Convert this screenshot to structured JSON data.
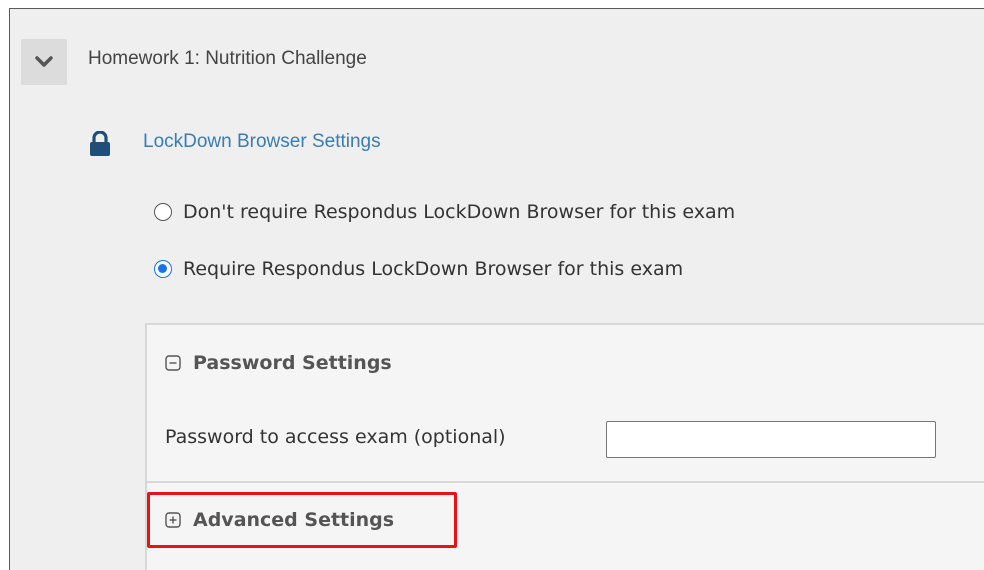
{
  "quiz": {
    "title": "Homework 1: Nutrition Challenge"
  },
  "lockdown": {
    "link_label": "LockDown Browser Settings",
    "options": [
      {
        "label": "Don't require Respondus LockDown Browser for this exam",
        "selected": false
      },
      {
        "label": "Require Respondus LockDown Browser for this exam",
        "selected": true
      }
    ]
  },
  "password_settings": {
    "header": "Password Settings",
    "state": "expanded",
    "field_label": "Password to access exam (optional)",
    "field_value": ""
  },
  "advanced_settings": {
    "header": "Advanced Settings",
    "state": "collapsed"
  },
  "colors": {
    "link": "#3a7db2",
    "radio_selected": "#1a73e8",
    "highlight_outline": "#e8121b"
  },
  "icons": {
    "expand_toggle": "chevron-down-icon",
    "lock": "lock-icon",
    "collapse_section": "minus-square-icon",
    "expand_section": "plus-square-icon"
  }
}
